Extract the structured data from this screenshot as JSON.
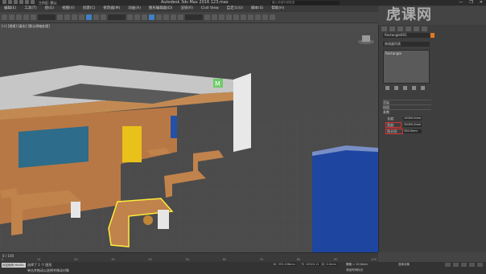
{
  "titlebar": {
    "title": "Autodesk 3ds Max 2016      123.max",
    "search_placeholder": "键入关键字或短语",
    "workspace": "工作区: 默认",
    "minimize": "—",
    "restore": "❐",
    "close": "✕"
  },
  "menu": [
    "编辑(E)",
    "工具(T)",
    "组(G)",
    "视图(V)",
    "创建(C)",
    "修改器(M)",
    "动画(A)",
    "图形编辑器(D)",
    "渲染(R)",
    "Civil View",
    "自定义(U)",
    "脚本(S)",
    "帮助(H)"
  ],
  "logo": "虎课网",
  "viewport": {
    "label": "[+] [透视] [真实] [默认明暗处理]",
    "sign_text": "M"
  },
  "command_panel": {
    "object_name": "Rectangle001",
    "modifier_list": "修改器列表",
    "stack_item": "Rectangle",
    "rollout_render": "渲染",
    "rollout_interp": "插值",
    "rollout_params": "参数",
    "length_label": "长度:",
    "length_value": "10000.0mm",
    "width_label": "宽度:",
    "width_value": "20000.0mm",
    "corner_label": "角半径:",
    "corner_value": "300.0mm",
    "swatch_color": "#e07a20"
  },
  "timeline": {
    "frame": "0 / 100",
    "ticks": [
      "0",
      "10",
      "20",
      "30",
      "40",
      "50",
      "60",
      "70",
      "80",
      "90",
      "100"
    ]
  },
  "status": {
    "mini_listener": "欢迎使用 MAXSc",
    "selected": "选择了 1 个 图形",
    "hint": "单击并拖动以选择并移动对象",
    "x_label": "X:",
    "x_value": "553.456mm",
    "y_label": "Y:",
    "y_value": "10520.12",
    "z_label": "Z:",
    "z_value": "0.0mm",
    "grid": "栅格 = 10.0mm",
    "add_time_tag": "添加时间标记",
    "selection_set": "选择对象"
  }
}
